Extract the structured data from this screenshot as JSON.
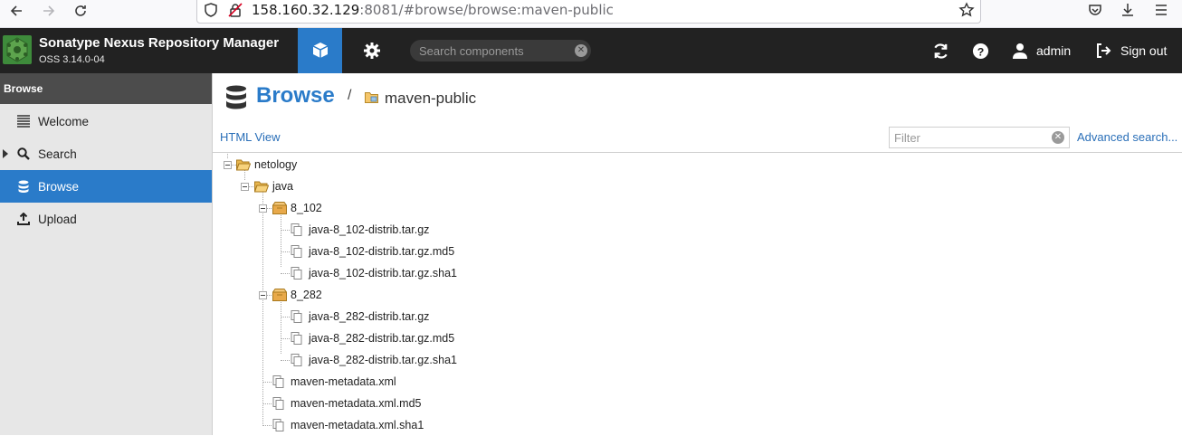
{
  "browser": {
    "url_host": "158.160.32.129",
    "url_rest": ":8081/#browse/browse:maven-public",
    "icons": [
      "back-icon",
      "forward-icon",
      "reload-icon",
      "shield-icon",
      "insecure-lock-icon",
      "bookmark-star-icon",
      "pocket-icon",
      "download-icon",
      "menu-icon"
    ]
  },
  "header": {
    "title": "Sonatype Nexus Repository Manager",
    "subtitle": "OSS 3.14.0-04",
    "search_placeholder": "Search components",
    "user": "admin",
    "sign_out": "Sign out",
    "accent": "#2a7bc9"
  },
  "sidebar": {
    "title": "Browse",
    "items": [
      {
        "label": "Welcome",
        "icon": "list-icon"
      },
      {
        "label": "Search",
        "icon": "search-icon"
      },
      {
        "label": "Browse",
        "icon": "database-icon"
      },
      {
        "label": "Upload",
        "icon": "upload-icon"
      }
    ]
  },
  "main": {
    "title": "Browse",
    "separator": "/",
    "repo": "maven-public",
    "html_view": "HTML View",
    "filter_placeholder": "Filter",
    "advanced_search": "Advanced search..."
  },
  "tree": {
    "nodes": [
      {
        "label": "netology",
        "type": "folder"
      },
      {
        "label": "java",
        "type": "folder"
      },
      {
        "label": "8_102",
        "type": "component"
      },
      {
        "label": "java-8_102-distrib.tar.gz",
        "type": "asset"
      },
      {
        "label": "java-8_102-distrib.tar.gz.md5",
        "type": "asset"
      },
      {
        "label": "java-8_102-distrib.tar.gz.sha1",
        "type": "asset"
      },
      {
        "label": "8_282",
        "type": "component"
      },
      {
        "label": "java-8_282-distrib.tar.gz",
        "type": "asset"
      },
      {
        "label": "java-8_282-distrib.tar.gz.md5",
        "type": "asset"
      },
      {
        "label": "java-8_282-distrib.tar.gz.sha1",
        "type": "asset"
      },
      {
        "label": "maven-metadata.xml",
        "type": "asset"
      },
      {
        "label": "maven-metadata.xml.md5",
        "type": "asset"
      },
      {
        "label": "maven-metadata.xml.sha1",
        "type": "asset"
      }
    ]
  }
}
